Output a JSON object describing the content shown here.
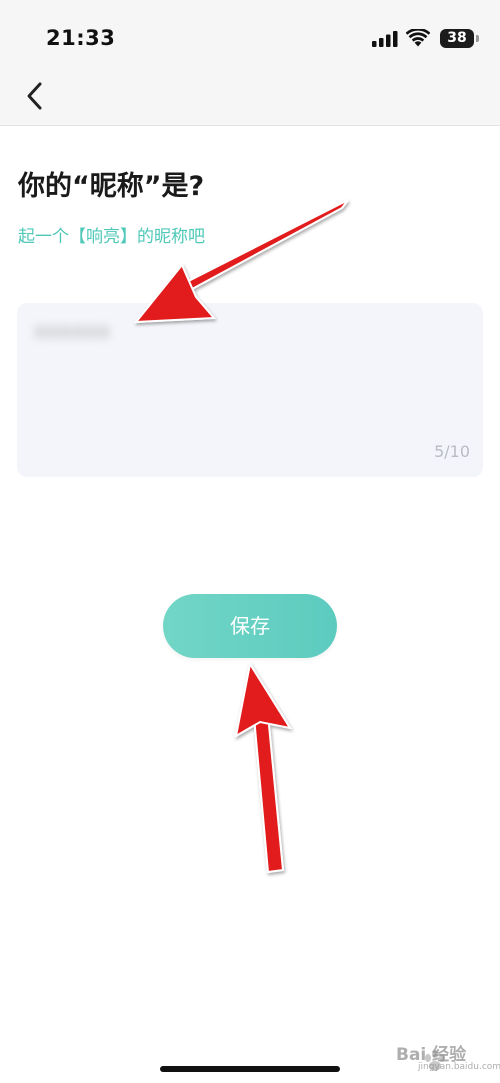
{
  "status_bar": {
    "time": "21:33",
    "battery_level": "38",
    "signal_icon": "cellular-signal-icon",
    "wifi_icon": "wifi-icon"
  },
  "nav": {
    "back_icon": "chevron-left-icon"
  },
  "header": {
    "title": "你的“昵称”是?",
    "subtitle": "起一个【响亮】的昵称吧"
  },
  "nickname_field": {
    "value": "xxxxxx",
    "counter": "5/10"
  },
  "actions": {
    "save_label": "保存"
  },
  "annotation": {
    "arrow_color": "#e21e1e"
  },
  "watermark": {
    "logo_text": "Bai 经验",
    "sub_text": "jingyan.baidu.com"
  },
  "colors": {
    "accent": "#5ccbbf",
    "subtitle": "#4fc8b8",
    "field_background": "#f4f5fa"
  }
}
